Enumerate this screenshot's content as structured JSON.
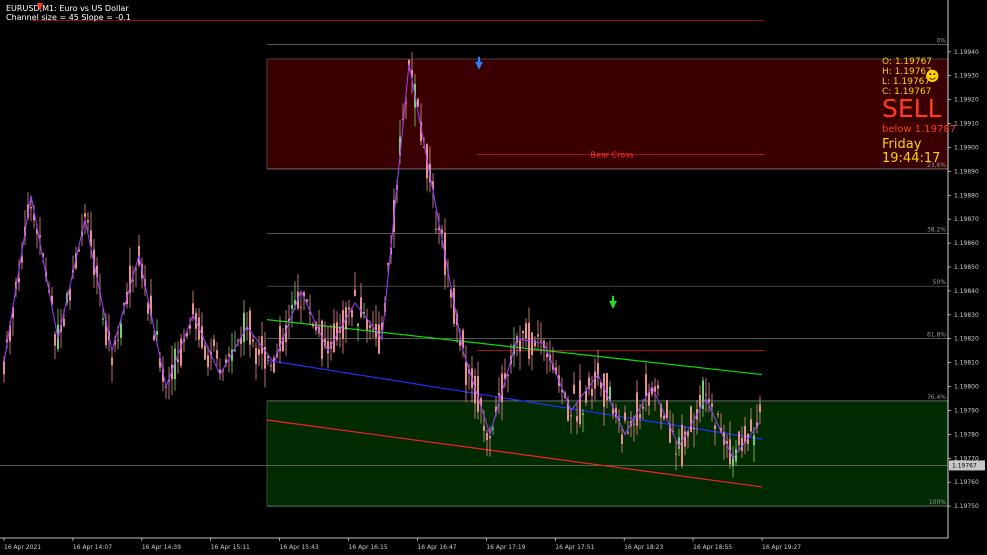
{
  "header": {
    "symbol_line": "EURUSD,M1: Euro vs US Dollar",
    "channel_line": "Channel size = 45 Slope = -0.1"
  },
  "ohlc": {
    "open": "O: 1.19767",
    "high": "H: 1.19767",
    "low": "L: 1.19767",
    "close": "C: 1.19767"
  },
  "signal": {
    "action": "SELL",
    "below": "below 1.19787",
    "day": "Friday",
    "time": "19:44:17"
  },
  "icons": {
    "header_arrow": "red-down-arrow-icon",
    "smiley": "smiley-face-icon"
  },
  "colors": {
    "background": "#000000",
    "candle": "#e89090",
    "zigzag": "#9a40ff",
    "channel_top": "#00e000",
    "channel_mid": "#2030ff",
    "channel_bottom": "#ff2020",
    "supply_zone": "#3a0000",
    "demand_zone": "#002a00",
    "text_yellow": "#ffd200",
    "sell_red": "#ff3c1e"
  },
  "annotations": {
    "bear_cross": "Bear Cross",
    "price_tag": "1.19767"
  },
  "chart_data": {
    "type": "candlestick",
    "symbol": "EURUSD",
    "timeframe": "M1",
    "y_range": [
      1.1974,
      1.1996
    ],
    "y_ticks": [
      "1.19940",
      "1.19930",
      "1.19920",
      "1.19910",
      "1.19900",
      "1.19890",
      "1.19880",
      "1.19870",
      "1.19860",
      "1.19850",
      "1.19840",
      "1.19830",
      "1.19820",
      "1.19810",
      "1.19800",
      "1.19790",
      "1.19780",
      "1.19770",
      "1.19760",
      "1.19750"
    ],
    "x_ticks": [
      "16 Apr 2021",
      "16 Apr 14:07",
      "16 Apr 14:39",
      "16 Apr 15:11",
      "16 Apr 15:43",
      "16 Apr 16:15",
      "16 Apr 16:47",
      "16 Apr 17:19",
      "16 Apr 17:51",
      "16 Apr 18:23",
      "16 Apr 18:55",
      "16 Apr 19:27"
    ],
    "fib_levels": [
      {
        "label": "0%",
        "price": 1.19943
      },
      {
        "label": "23.6%",
        "price": 1.19891
      },
      {
        "label": "38.2%",
        "price": 1.19864
      },
      {
        "label": "50%",
        "price": 1.19842
      },
      {
        "label": "61.8%",
        "price": 1.1982
      },
      {
        "label": "76.4%",
        "price": 1.19794
      },
      {
        "label": "100%",
        "price": 1.1975
      }
    ],
    "zones": [
      {
        "name": "supply",
        "from": 1.19891,
        "to": 1.19937
      },
      {
        "name": "demand",
        "from": 1.1975,
        "to": 1.19794
      }
    ],
    "resistance_lines": [
      1.19953,
      1.19897,
      1.19815
    ],
    "current_price": 1.19767,
    "channel": {
      "top": [
        1.19828,
        1.19805
      ],
      "middle": [
        1.19811,
        1.19778
      ],
      "bottom": [
        1.19786,
        1.19758
      ]
    },
    "arrows": [
      {
        "direction": "down",
        "color": "blue",
        "price": 1.1993
      },
      {
        "direction": "down",
        "color": "green",
        "price": 1.1983
      }
    ],
    "zigzag": [
      1.1981,
      1.1988,
      1.1982,
      1.1987,
      1.19815,
      1.19855,
      1.198,
      1.1983,
      1.19805,
      1.19825,
      1.1981,
      1.1984,
      1.19815,
      1.19835,
      1.1982,
      1.19935,
      1.19875,
      1.19815,
      1.1978,
      1.1982,
      1.19818,
      1.1979,
      1.19805,
      1.1978,
      1.198,
      1.19775,
      1.19795,
      1.1977,
      1.19785
    ]
  }
}
